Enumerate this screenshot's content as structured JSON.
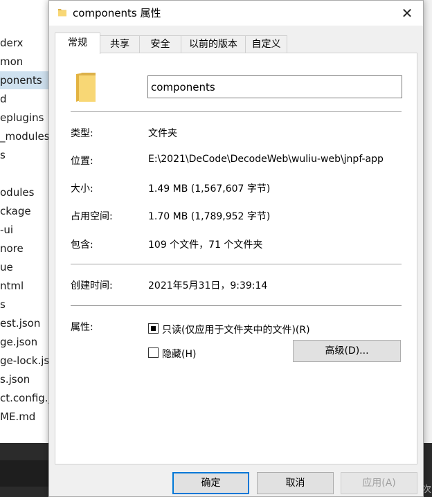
{
  "background": {
    "explorer_items": [
      {
        "label": "derx",
        "selected": false
      },
      {
        "label": "mon",
        "selected": false
      },
      {
        "label": "ponents",
        "selected": true
      },
      {
        "label": "d",
        "selected": false
      },
      {
        "label": "eplugins",
        "selected": false
      },
      {
        "label": "_modules",
        "selected": false
      },
      {
        "label": "s",
        "selected": false
      },
      {
        "label": "",
        "selected": false
      },
      {
        "label": "odules",
        "selected": false
      },
      {
        "label": "ckage",
        "selected": false
      },
      {
        "label": "-ui",
        "selected": false
      },
      {
        "label": "nore",
        "selected": false
      },
      {
        "label": "ue",
        "selected": false
      },
      {
        "label": "ntml",
        "selected": false
      },
      {
        "label": "s",
        "selected": false
      },
      {
        "label": "est.json",
        "selected": false
      },
      {
        "label": "ge.json",
        "selected": false
      },
      {
        "label": "ge-lock.js",
        "selected": false
      },
      {
        "label": "s.json",
        "selected": false
      },
      {
        "label": "ct.config.j",
        "selected": false
      },
      {
        "label": "ME.md",
        "selected": false
      }
    ],
    "right_edge_text": "次"
  },
  "dialog": {
    "title": "components 属性",
    "close_glyph": "✕",
    "tabs": [
      {
        "label": "常规",
        "active": true
      },
      {
        "label": "共享",
        "active": false
      },
      {
        "label": "安全",
        "active": false
      },
      {
        "label": "以前的版本",
        "active": false
      },
      {
        "label": "自定义",
        "active": false
      }
    ],
    "name_value": "components",
    "type_label": "类型:",
    "type_value": "文件夹",
    "location_label": "位置:",
    "location_value": "E:\\2021\\DeCode\\DecodeWeb\\wuliu-web\\jnpf-app",
    "size_label": "大小:",
    "size_value": "1.49 MB (1,567,607 字节)",
    "disk_label": "占用空间:",
    "disk_value": "1.70 MB (1,789,952 字节)",
    "contains_label": "包含:",
    "contains_value": "109 个文件，71 个文件夹",
    "created_label": "创建时间:",
    "created_value": "2021年5月31日，9:39:14",
    "attributes_label": "属性:",
    "readonly_label": "只读(仅应用于文件夹中的文件)(R)",
    "readonly_checked": true,
    "hidden_label": "隐藏(H)",
    "hidden_checked": false,
    "advanced_label": "高级(D)...",
    "ok_label": "确定",
    "cancel_label": "取消",
    "apply_label": "应用(A)",
    "folder_color": "#f8d775",
    "accent_color": "#0078d7"
  }
}
